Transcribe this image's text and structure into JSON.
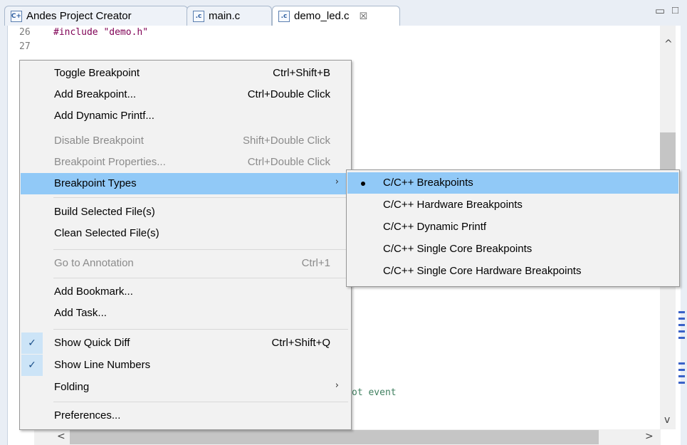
{
  "tabs": [
    {
      "label": "Andes Project Creator",
      "icon": "cpp-project-icon"
    },
    {
      "label": "main.c",
      "icon": "c-file-icon"
    },
    {
      "label": "demo_led.c",
      "icon": "c-file-icon",
      "close": "☒",
      "active": true
    }
  ],
  "editor": {
    "lines": [
      {
        "num": "26",
        "code": "#include \"demo.h\""
      },
      {
        "num": "27",
        "code": ""
      }
    ],
    "partial_code": "ot event"
  },
  "context_menu": {
    "items": [
      {
        "label": "Toggle Breakpoint",
        "shortcut": "Ctrl+Shift+B"
      },
      {
        "label": "Add Breakpoint...",
        "shortcut": "Ctrl+Double Click"
      },
      {
        "label": "Add Dynamic Printf...",
        "shortcut": ""
      },
      {
        "label": "Disable Breakpoint",
        "shortcut": "Shift+Double Click",
        "disabled": true
      },
      {
        "label": "Breakpoint Properties...",
        "shortcut": "Ctrl+Double Click",
        "disabled": true
      },
      {
        "label": "Breakpoint Types",
        "shortcut": "",
        "submenu": true,
        "highlighted": true
      },
      {
        "label": "Build Selected File(s)",
        "shortcut": ""
      },
      {
        "label": "Clean Selected File(s)",
        "shortcut": ""
      },
      {
        "label": "Go to Annotation",
        "shortcut": "Ctrl+1",
        "disabled": true
      },
      {
        "label": "Add Bookmark...",
        "shortcut": ""
      },
      {
        "label": "Add Task...",
        "shortcut": ""
      },
      {
        "label": "Show Quick Diff",
        "shortcut": "Ctrl+Shift+Q",
        "checked": true
      },
      {
        "label": "Show Line Numbers",
        "shortcut": "",
        "checked": true
      },
      {
        "label": "Folding",
        "shortcut": "",
        "submenu": true
      },
      {
        "label": "Preferences...",
        "shortcut": ""
      }
    ]
  },
  "breakpoint_types_submenu": {
    "items": [
      {
        "label": "C/C++ Breakpoints",
        "selected": true
      },
      {
        "label": "C/C++ Hardware Breakpoints"
      },
      {
        "label": "C/C++ Dynamic Printf"
      },
      {
        "label": "C/C++ Single Core Breakpoints"
      },
      {
        "label": "C/C++ Single Core Hardware Breakpoints"
      }
    ]
  },
  "glyphs": {
    "submenu_arrow": "›",
    "check": "✓",
    "scroll_up": "^",
    "scroll_down": "v",
    "scroll_left": "<",
    "scroll_right": ">"
  },
  "colors": {
    "highlight": "#91c9f7",
    "menu_bg": "#f2f2f2",
    "disabled_text": "#8b8b8b",
    "keyword": "#7f0055",
    "string": "#2a00ff",
    "comment": "#3f7f5f"
  }
}
